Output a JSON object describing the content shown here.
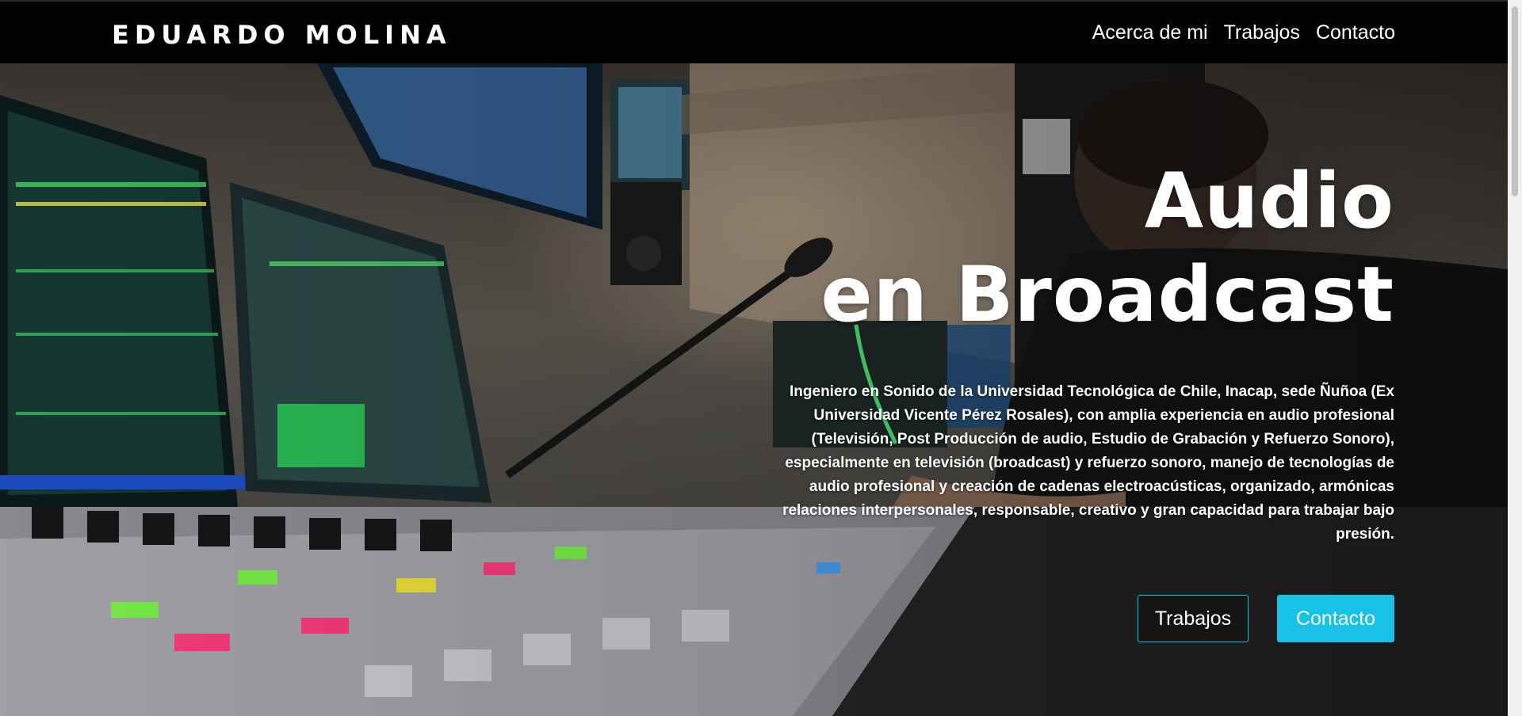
{
  "nav": {
    "brand": "EDUARDO MOLINA",
    "links": [
      "Acerca de mi",
      "Trabajos",
      "Contacto"
    ]
  },
  "hero": {
    "title_line1": "Audio",
    "title_line2": "en Broadcast",
    "description": "Ingeniero en Sonido de la Universidad Tecnológica de Chile, Inacap, sede Ñuñoa (Ex Universidad Vicente Pérez Rosales), con amplia experiencia en audio profesional (Televisión, Post Producción de audio, Estudio de Grabación y Refuerzo Sonoro), especialmente en televisión (broadcast) y refuerzo sonoro, manejo de tecnologías de audio profesional y creación de cadenas electroacústicas, organizado, armónicas relaciones interpersonales, responsable, creativo y gran capacidad para trabajar bajo presión.",
    "buttons": {
      "outline": "Trabajos",
      "solid": "Contacto"
    },
    "accent_color": "#17c1e8"
  }
}
